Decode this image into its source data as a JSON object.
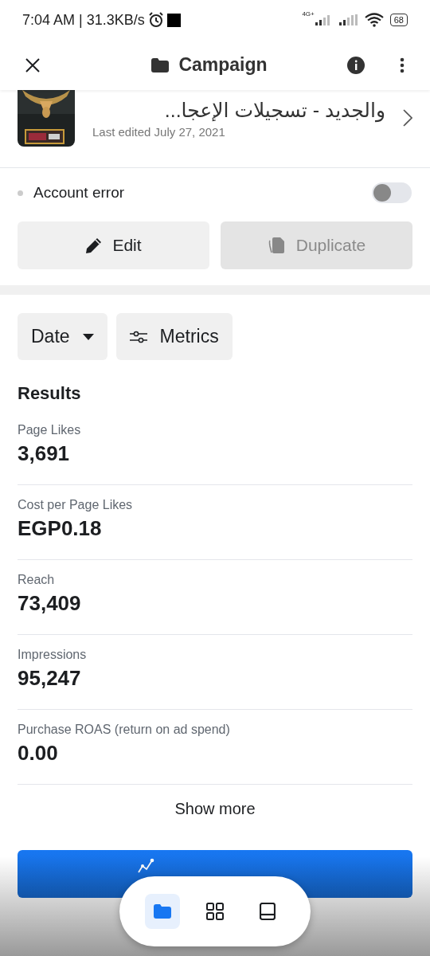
{
  "status_bar": {
    "time": "7:04 AM | 31.3KB/s",
    "network": "4G+",
    "battery": "68"
  },
  "header": {
    "title": "Campaign"
  },
  "campaign": {
    "title": "والجديد - تسجيلات الإعجا...",
    "edited": "Last edited July 27, 2021",
    "status": "Account error",
    "toggle_on": false
  },
  "actions": [
    {
      "kind": "edit",
      "label": "Edit",
      "disabled": false
    },
    {
      "kind": "duplicate",
      "label": "Duplicate",
      "disabled": true
    }
  ],
  "filters": [
    {
      "kind": "dropdown",
      "label": "Date"
    },
    {
      "kind": "metrics",
      "label": "Metrics"
    }
  ],
  "results": {
    "heading": "Results",
    "metrics": [
      {
        "label": "Page Likes",
        "value": "3,691"
      },
      {
        "label": "Cost per Page Likes",
        "value": "EGP0.18"
      },
      {
        "label": "Reach",
        "value": "73,409"
      },
      {
        "label": "Impressions",
        "value": "95,247"
      },
      {
        "label": "Purchase ROAS (return on ad spend)",
        "value": "0.00"
      }
    ],
    "show_more": "Show more"
  },
  "primary_button": {
    "kind": "chart"
  },
  "bottom_nav": [
    {
      "kind": "folder",
      "selected": true
    },
    {
      "kind": "grid",
      "selected": false
    },
    {
      "kind": "tablet",
      "selected": false
    }
  ]
}
